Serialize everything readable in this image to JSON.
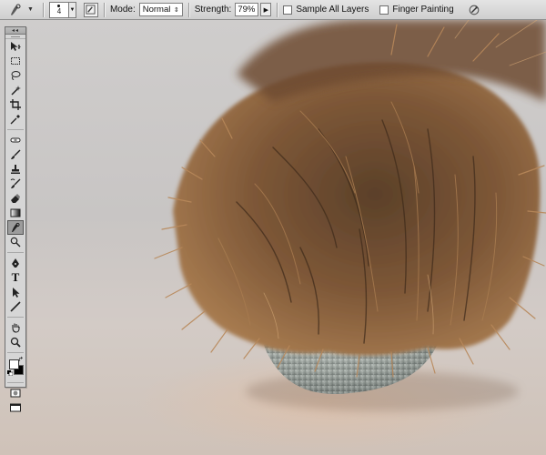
{
  "options_bar": {
    "tool_icon": "smudge-icon",
    "brush_size": "4",
    "mode_label": "Mode:",
    "mode_value": "Normal",
    "strength_label": "Strength:",
    "strength_value": "79%",
    "sample_all_layers_label": "Sample All Layers",
    "sample_all_layers_checked": false,
    "finger_painting_label": "Finger Painting",
    "finger_painting_checked": false,
    "pressure_icon": "pen-pressure-icon"
  },
  "tools_panel": {
    "tools": [
      {
        "name": "move-tool",
        "icon": "move-icon",
        "active": false
      },
      {
        "name": "marquee-tool",
        "icon": "rect-marquee-icon",
        "active": false
      },
      {
        "name": "lasso-tool",
        "icon": "lasso-icon",
        "active": false
      },
      {
        "name": "quick-selection-tool",
        "icon": "magic-wand-icon",
        "active": false
      },
      {
        "name": "crop-tool",
        "icon": "crop-icon",
        "active": false
      },
      {
        "name": "eyedropper-tool",
        "icon": "eyedropper-icon",
        "active": false
      },
      {
        "name": "spot-healing-tool",
        "icon": "bandage-icon",
        "active": false
      },
      {
        "name": "brush-tool",
        "icon": "brush-icon",
        "active": false
      },
      {
        "name": "clone-stamp-tool",
        "icon": "stamp-icon",
        "active": false
      },
      {
        "name": "history-brush-tool",
        "icon": "history-brush-icon",
        "active": false
      },
      {
        "name": "eraser-tool",
        "icon": "eraser-icon",
        "active": false
      },
      {
        "name": "gradient-tool",
        "icon": "gradient-icon",
        "active": false
      },
      {
        "name": "smudge-tool",
        "icon": "smudge-icon",
        "active": true
      },
      {
        "name": "dodge-tool",
        "icon": "dodge-icon",
        "active": false
      },
      {
        "name": "pen-tool",
        "icon": "pen-icon",
        "active": false
      },
      {
        "name": "type-tool",
        "icon": "type-icon",
        "active": false
      },
      {
        "name": "path-selection-tool",
        "icon": "path-select-icon",
        "active": false
      },
      {
        "name": "line-tool",
        "icon": "line-icon",
        "active": false
      },
      {
        "name": "hand-tool",
        "icon": "hand-icon",
        "active": false
      },
      {
        "name": "zoom-tool",
        "icon": "zoom-icon",
        "active": false
      }
    ],
    "type_tool_glyph": "T",
    "foreground_color": "#ffffff",
    "background_color": "#000000",
    "quick_mask_icon": "quick-mask-icon",
    "screen_mode_icon": "screen-mode-icon"
  },
  "colors": {
    "fur_dark": "#4a3423",
    "fur_mid": "#7d5737",
    "fur_light": "#b08356",
    "sphere": "#9aa09c",
    "backdrop": "#cbc8c6",
    "floor_glow": "#e0bca2"
  }
}
